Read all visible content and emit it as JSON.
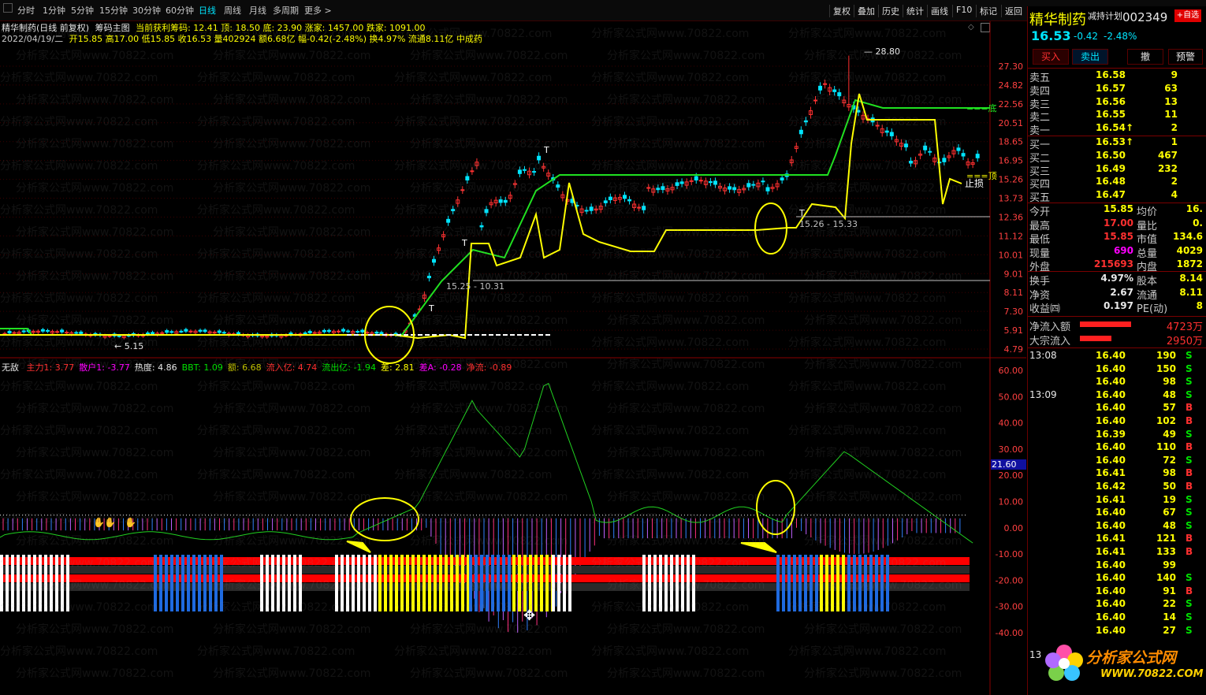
{
  "toolbar": {
    "periods": [
      "分时",
      "1分钟",
      "5分钟",
      "15分钟",
      "30分钟",
      "60分钟",
      "日线",
      "周线",
      "月线",
      "多周期",
      "更多 >"
    ],
    "active_period": "日线",
    "right_buttons": [
      "复权",
      "叠加",
      "历史",
      "统计",
      "画线",
      "F10",
      "标记",
      "返回"
    ]
  },
  "chart": {
    "title": "精华制药(日线 前复权)",
    "main_indicator": "筹码主图",
    "stats_line1": "当前获利筹码: 12.41  顶: 18.50  底: 23.90  涨家: 1457.00  跌家: 1091.00",
    "date": "2022/04/19/二",
    "stats_line2": "开15.85 高17.00 低15.85 收16.53 量402924 额6.68亿 幅-0.42(-2.48%) 换4.97% 流通8.11亿 中成药",
    "price_axis": [
      "27.30",
      "24.82",
      "22.56",
      "20.51",
      "18.65",
      "16.95",
      "15.26",
      "13.73",
      "12.36",
      "11.12",
      "10.01",
      "9.01",
      "8.11",
      "7.30",
      "5.91",
      "4.79"
    ],
    "annotations": {
      "high": "28.80",
      "low": "5.15",
      "range1": "15.25 - 10.31",
      "range2": "15.26 - 15.33",
      "top_label": "顶",
      "bottom_label": "底",
      "stop": "止损",
      "t_mark": "T"
    },
    "sub_title": "无敌",
    "sub_stats": [
      {
        "text": "主力1: 3.77",
        "color": "#ff3030"
      },
      {
        "text": "散户1: -3.77",
        "color": "#ff00ff"
      },
      {
        "text": "热度: 4.86",
        "color": "#e8e8e8"
      },
      {
        "text": "BBT: 1.09",
        "color": "#00e000"
      },
      {
        "text": "额: 6.68",
        "color": "#c0c000"
      },
      {
        "text": "流入亿: 4.74",
        "color": "#ff3030"
      },
      {
        "text": "流出亿: -1.94",
        "color": "#00e000"
      },
      {
        "text": "差: 2.81",
        "color": "#ffff00"
      },
      {
        "text": "差A: -0.28",
        "color": "#ff00ff"
      },
      {
        "text": "净流: -0.89",
        "color": "#ff3030"
      }
    ],
    "sub_axis": [
      "60.00",
      "50.00",
      "40.00",
      "30.00",
      "20.00",
      "10.00",
      "0.00",
      "-10.00",
      "-20.00",
      "-30.00",
      "-40.00"
    ],
    "sub_axis_highlight": "21.60"
  },
  "quote": {
    "name": "精华制药",
    "plan": "减持计划",
    "code": "002349",
    "price": "16.53",
    "change": "-0.42",
    "pct": "-2.48%",
    "buttons": [
      "买入",
      "卖出",
      "撤",
      "预警"
    ],
    "asks": [
      {
        "label": "卖五",
        "price": "16.58",
        "vol": "9"
      },
      {
        "label": "卖四",
        "price": "16.57",
        "vol": "63"
      },
      {
        "label": "卖三",
        "price": "16.56",
        "vol": "13"
      },
      {
        "label": "卖二",
        "price": "16.55",
        "vol": "11"
      },
      {
        "label": "卖一",
        "price": "16.54↑",
        "vol": "2"
      }
    ],
    "bids": [
      {
        "label": "买一",
        "price": "16.53↑",
        "vol": "1"
      },
      {
        "label": "买二",
        "price": "16.50",
        "vol": "467"
      },
      {
        "label": "买三",
        "price": "16.49",
        "vol": "232"
      },
      {
        "label": "买四",
        "price": "16.48",
        "vol": "2"
      },
      {
        "label": "买五",
        "price": "16.47",
        "vol": "4"
      }
    ],
    "stats": [
      {
        "l1": "今开",
        "v1": "15.85",
        "l2": "均价",
        "v2": "16."
      },
      {
        "l1": "最高",
        "v1": "17.00",
        "l2": "量比",
        "v2": "0."
      },
      {
        "l1": "最低",
        "v1": "15.85",
        "l2": "市值",
        "v2": "134.6"
      },
      {
        "l1": "现量",
        "v1": "690",
        "l2": "总量",
        "v2": "4029"
      },
      {
        "l1": "外盘",
        "v1": "215693",
        "l2": "内盘",
        "v2": "1872"
      }
    ],
    "stats2": [
      {
        "l1": "换手",
        "v1": "4.97%",
        "l2": "股本",
        "v2": "8.14"
      },
      {
        "l1": "净资",
        "v1": "2.67",
        "l2": "流通",
        "v2": "8.11"
      },
      {
        "l1": "收益㈣",
        "v1": "0.197",
        "l2": "PE(动)",
        "v2": "8"
      }
    ],
    "flows": [
      {
        "label": "净流入额",
        "value": "4723万"
      },
      {
        "label": "大宗流入",
        "value": "2950万"
      }
    ],
    "flow_levels": [
      0.62,
      0.38
    ],
    "ticks": [
      {
        "time": "13:08",
        "price": "16.40",
        "vol": "190",
        "side": "S"
      },
      {
        "time": "",
        "price": "16.40",
        "vol": "150",
        "side": "S"
      },
      {
        "time": "",
        "price": "16.40",
        "vol": "98",
        "side": "S"
      },
      {
        "time": "13:09",
        "price": "16.40",
        "vol": "48",
        "side": "S"
      },
      {
        "time": "",
        "price": "16.40",
        "vol": "57",
        "side": "B"
      },
      {
        "time": "",
        "price": "16.40",
        "vol": "102",
        "side": "B"
      },
      {
        "time": "",
        "price": "16.39",
        "vol": "49",
        "side": "S"
      },
      {
        "time": "",
        "price": "16.40",
        "vol": "110",
        "side": "B"
      },
      {
        "time": "",
        "price": "16.40",
        "vol": "72",
        "side": "S"
      },
      {
        "time": "",
        "price": "16.41",
        "vol": "98",
        "side": "B"
      },
      {
        "time": "",
        "price": "16.42",
        "vol": "50",
        "side": "B"
      },
      {
        "time": "",
        "price": "16.41",
        "vol": "19",
        "side": "S"
      },
      {
        "time": "",
        "price": "16.40",
        "vol": "67",
        "side": "S"
      },
      {
        "time": "",
        "price": "16.40",
        "vol": "48",
        "side": "S"
      },
      {
        "time": "",
        "price": "16.41",
        "vol": "121",
        "side": "B"
      },
      {
        "time": "",
        "price": "16.41",
        "vol": "133",
        "side": "B"
      },
      {
        "time": "",
        "price": "16.40",
        "vol": "99",
        "side": ""
      },
      {
        "time": "",
        "price": "16.40",
        "vol": "140",
        "side": "S"
      },
      {
        "time": "",
        "price": "16.40",
        "vol": "91",
        "side": "B"
      },
      {
        "time": "",
        "price": "16.40",
        "vol": "22",
        "side": "S"
      },
      {
        "time": "",
        "price": "16.40",
        "vol": "14",
        "side": "S"
      },
      {
        "time": "",
        "price": "16.40",
        "vol": "27",
        "side": "S"
      }
    ],
    "tick_last_time": "13"
  },
  "watermark": {
    "brand": "分析家公式网",
    "url": "WWW.70822.COM"
  },
  "colors": {
    "up": "#ff3030",
    "down": "#00e5ff",
    "ma_green": "#20e020",
    "line_yellow": "#ffff00",
    "bar_blue": "#1e6ae0",
    "bar_white": "#ffffff",
    "bar_red": "#ff0000"
  }
}
